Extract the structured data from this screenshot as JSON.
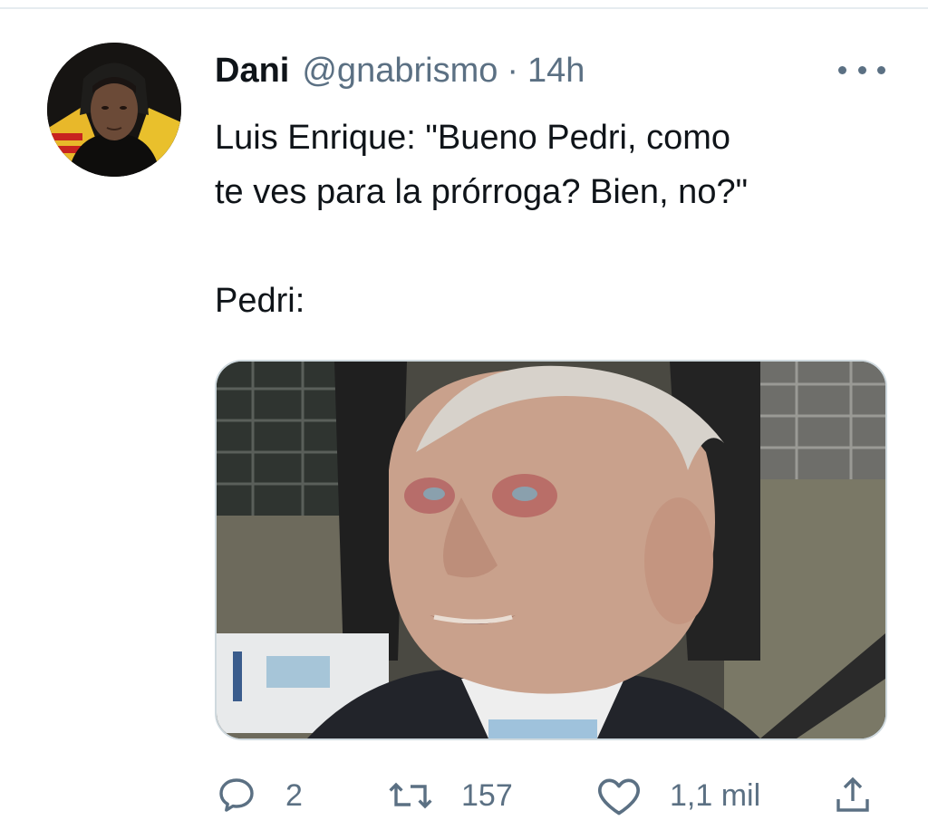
{
  "tweet": {
    "author": {
      "name": "Dani",
      "handle": "@gnabrismo",
      "avatar_icon": "profile-photo"
    },
    "separator": "·",
    "time": "14h",
    "text_lines": [
      "Luis Enrique: \"Bueno Pedri, como",
      "te ves para la prórroga? Bien, no?\"",
      "Pedri:"
    ],
    "media_icon": "photo-elderly-man-in-car"
  },
  "actions": {
    "reply": {
      "icon": "reply-icon",
      "count": "2"
    },
    "retweet": {
      "icon": "retweet-icon",
      "count": "157"
    },
    "like": {
      "icon": "heart-icon",
      "count": "1,1 mil"
    },
    "share": {
      "icon": "share-icon"
    }
  },
  "colors": {
    "text": "#0f1419",
    "secondary": "#5b7083",
    "divider": "#e6ecf0"
  }
}
